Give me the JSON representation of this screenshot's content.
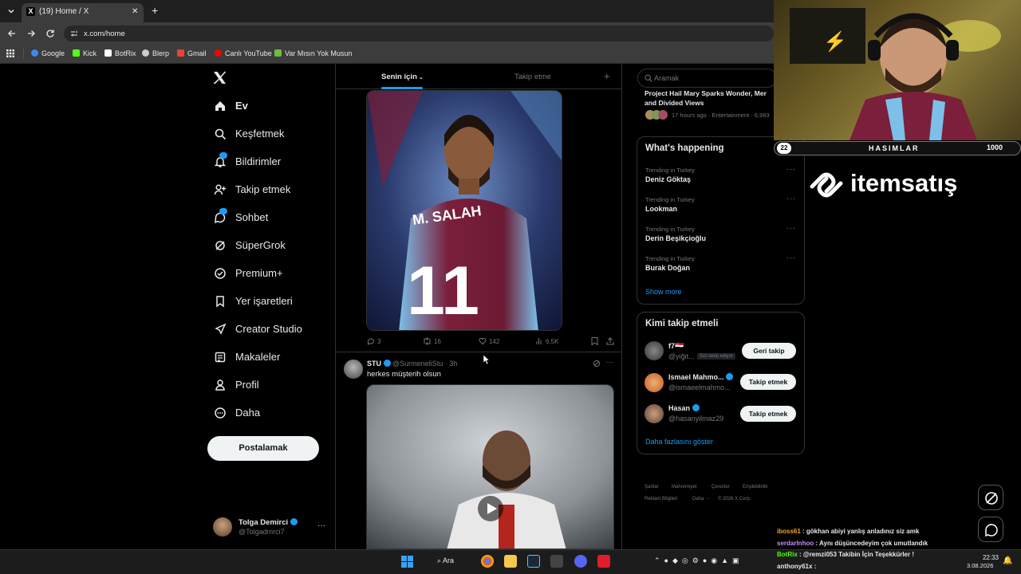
{
  "browser": {
    "tab_title": "(19) Home / X",
    "new_tab": "+",
    "url": "x.com/home",
    "bookmarks": [
      {
        "label": "Google",
        "color": "#4285f4"
      },
      {
        "label": "Kick",
        "color": "#53fc18"
      },
      {
        "label": "BotRix",
        "color": "#ffffff"
      },
      {
        "label": "Blerp",
        "color": "#cccccc"
      },
      {
        "label": "Gmail",
        "color": "#ea4335"
      },
      {
        "label": "Canlı YouTube",
        "color": "#ff0000"
      },
      {
        "label": "Var Mısın Yok Musun",
        "color": "#6bbf3a"
      }
    ]
  },
  "sidebar": {
    "logo": "x-logo-icon",
    "items": [
      {
        "label": "Ev",
        "icon": "home-icon"
      },
      {
        "label": "Keşfetmek",
        "icon": "search-icon"
      },
      {
        "label": "Bildirimler",
        "icon": "bell-icon",
        "badge": "19"
      },
      {
        "label": "Takip etmek",
        "icon": "person-add-icon"
      },
      {
        "label": "Sohbet",
        "icon": "chat-icon",
        "badge": "1"
      },
      {
        "label": "SüperGrok",
        "icon": "grok-icon"
      },
      {
        "label": "Premium+",
        "icon": "premium-icon"
      },
      {
        "label": "Yer işaretleri",
        "icon": "bookmark-icon"
      },
      {
        "label": "Creator Studio",
        "icon": "rocket-icon"
      },
      {
        "label": "Makaleler",
        "icon": "article-icon"
      },
      {
        "label": "Profil",
        "icon": "person-icon"
      },
      {
        "label": "Daha",
        "icon": "more-circle-icon"
      }
    ],
    "post_button": "Postalamak",
    "user": {
      "name": "Tolga Demirci",
      "handle": "@Tolgadmrci7",
      "more": "···"
    }
  },
  "feed": {
    "tabs": [
      {
        "label": "Senin için",
        "active": true
      },
      {
        "label": "Takip etme",
        "active": false
      }
    ],
    "add": "+",
    "tweet1": {
      "image_text": "M. SALAH 11",
      "replies": "3",
      "retweets": "16",
      "likes": "142",
      "views": "6,5K"
    },
    "tweet2": {
      "name": "STU",
      "handle": "@SurmeneliStu",
      "time": "· 3h",
      "more": "···",
      "text": "herkes müşterih olsun"
    }
  },
  "right": {
    "search_placeholder": "Aramak",
    "top_news": {
      "title": "Project Hail Mary Sparks Wonder, Mer and Divided Views",
      "meta": "17 hours ago · Entertainment · 6,983"
    },
    "whats_happening": {
      "title": "What's happening",
      "trends": [
        {
          "category": "Trending in Turkey",
          "name": "Deniz Göktaş"
        },
        {
          "category": "Trending in Turkey",
          "name": "Lookman"
        },
        {
          "category": "Trending in Turkey",
          "name": "Derin Beşikçioğlu"
        },
        {
          "category": "Trending in Turkey",
          "name": "Burak Doğan"
        }
      ],
      "show_more": "Show more"
    },
    "who_to_follow": {
      "title": "Kimi takip etmeli",
      "users": [
        {
          "name": "f7🇪🇬",
          "handle": "@yiğit...",
          "tag": "Sizi takip ediyor",
          "button": "Geri takip"
        },
        {
          "name": "Ismael Mahmo...",
          "handle": "@ismaeelmahmo...",
          "button": "Takip etmek"
        },
        {
          "name": "Hasan",
          "handle": "@hasanyilmaz29",
          "button": "Takip etmek"
        }
      ],
      "show_more": "Daha fazlasını göster"
    },
    "footer": [
      "Şartlar",
      "Mahremiyet",
      "Çerezler",
      "Erişilebilirlik",
      "Reklam Bilgileri",
      "Daha ···",
      "© 2026 X Corp."
    ]
  },
  "overlay": {
    "hasimlar_left": "22",
    "hasimlar_title": "HASIMLAR",
    "hasimlar_right": "1000",
    "sponsor": "itemsatış",
    "chat": [
      {
        "user": "iboss61",
        "sep": " : ",
        "text": "gökhan abiyi yanlış anladınız siz amk",
        "color": "#f5a623"
      },
      {
        "user": "serdarlnhoo",
        "sep": " : ",
        "text": "Aynı düşüncedeyim çok umutlandık",
        "color": "#c98cff"
      },
      {
        "user": "BotRix",
        "sep": " : ",
        "text": "@remzi053 Takibin İçin Teşekkürler !",
        "color": "#53fc18"
      },
      {
        "user": "anthony61x",
        "sep": " : ",
        "text": "",
        "color": "#e7e9ea"
      }
    ]
  },
  "taskbar": {
    "search": "Ara",
    "time": "22:33",
    "date": "3.08.2026"
  }
}
